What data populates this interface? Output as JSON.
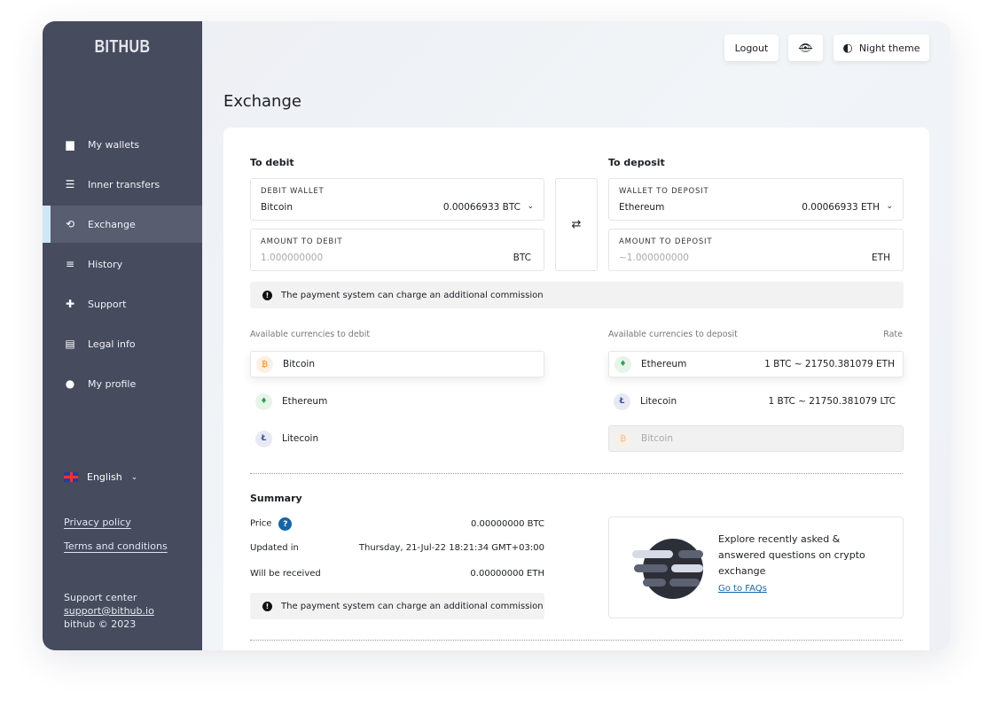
{
  "app": {
    "logo": "BITHUB"
  },
  "sidebar": {
    "items": [
      {
        "label": "My wallets",
        "icon": "wallet-icon",
        "glyph": "▆"
      },
      {
        "label": "Inner transfers",
        "icon": "transfer-icon",
        "glyph": "☰"
      },
      {
        "label": "Exchange",
        "icon": "exchange-icon",
        "glyph": "⟲",
        "active": true
      },
      {
        "label": "History",
        "icon": "history-icon",
        "glyph": "≡"
      },
      {
        "label": "Support",
        "icon": "support-icon",
        "glyph": "✚"
      },
      {
        "label": "Legal info",
        "icon": "document-icon",
        "glyph": "▤"
      },
      {
        "label": "My profile",
        "icon": "user-icon",
        "glyph": "●"
      }
    ],
    "language": "English",
    "privacy": "Privacy policy",
    "terms": "Terms and conditions",
    "support_label": "Support center",
    "support_email": "support@bithub.io",
    "copyright": "bithub © 2023"
  },
  "header": {
    "logout": "Logout",
    "night_theme": "Night theme"
  },
  "page": {
    "title": "Exchange"
  },
  "debit": {
    "heading": "To debit",
    "wallet_label": "DEBIT WALLET",
    "wallet": "Bitcoin",
    "balance": "0.00066933 BTC",
    "amount_label": "AMOUNT TO DEBIT",
    "amount_placeholder": "1.000000000",
    "amount_unit": "BTC"
  },
  "deposit": {
    "heading": "To deposit",
    "wallet_label": "WALLET TO DEPOSIT",
    "wallet": "Ethereum",
    "balance": "0.00066933 ETH",
    "amount_label": "AMOUNT TO DEPOSIT",
    "amount_placeholder": "~1.000000000",
    "amount_unit": "ETH"
  },
  "notice": "The payment system can charge an additional commission",
  "available_debit": {
    "label": "Available currencies to debit",
    "items": [
      "Bitcoin",
      "Ethereum",
      "Litecoin"
    ]
  },
  "available_deposit": {
    "label": "Available currencies to deposit",
    "rate_label": "Rate",
    "items": [
      {
        "name": "Ethereum",
        "rate": "1 BTC ~ 21750.381079 ETH"
      },
      {
        "name": "Litecoin",
        "rate": "1 BTC ~ 21750.381079 LTC"
      },
      {
        "name": "Bitcoin",
        "rate": ""
      }
    ]
  },
  "summary": {
    "heading": "Summary",
    "price_label": "Price",
    "price": "0.00000000 BTC",
    "updated_label": "Updated in",
    "updated": "Thursday, 21-Jul-22 18:21:34 GMT+03:00",
    "received_label": "Will be received",
    "received": "0.00000000 ETH"
  },
  "faq": {
    "text": "Explore recently asked & answered questions on crypto exchange",
    "link": "Go to FAQs"
  },
  "colors": {
    "sidebar": "#464b5e",
    "active_indicator": "#cfe6f7",
    "link": "#1565a8"
  }
}
